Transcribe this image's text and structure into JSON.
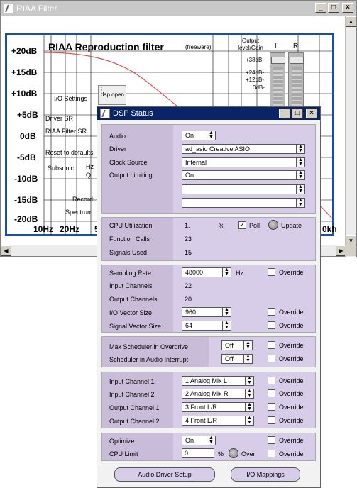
{
  "riaa_window": {
    "title": "RIAA Filter",
    "plot_title": "RIAA Reproduction filter",
    "freeware": "(freeware)",
    "db_labels": [
      "+20dB",
      "+15dB",
      "+10dB",
      "+5dB",
      "0dB",
      "-5dB",
      "-10dB",
      "-15dB",
      "-20dB"
    ],
    "freq_labels": [
      "10Hz",
      "20Hz",
      "5",
      "0kh"
    ],
    "side_labels": {
      "io_settings": "I/O Settings",
      "driver_sr": "Driver SR",
      "riaa_filter_sr": "RIAA Filter SR",
      "reset": "Reset to defaults",
      "subsonic": "Subsonic",
      "hz": "Hz",
      "q": "Q",
      "record": "Record:",
      "spectrum": "Spectrum:"
    },
    "dsp_open": "dsp open",
    "output_label": "Output level/Gain",
    "meter_labels": [
      "+38dB-",
      "+24dB-",
      "+12dB-",
      "0dB-"
    ],
    "meter_channels": [
      "L",
      "R"
    ]
  },
  "dsp_window": {
    "title": "DSP Status",
    "section1": {
      "audio_label": "Audio",
      "audio_value": "On",
      "driver_label": "Driver",
      "driver_value": "ad_asio Creative ASIO",
      "clock_label": "Clock Source",
      "clock_value": "Internal",
      "limiting_label": "Output Limiting",
      "limiting_value": "On"
    },
    "section2": {
      "cpu_label": "CPU Utilization",
      "cpu_value": "1.",
      "cpu_unit": "%",
      "poll_label": "Poll",
      "poll_checked": "✓",
      "update_label": "Update",
      "fcalls_label": "Function Calls",
      "fcalls_value": "23",
      "signals_label": "Signals Used",
      "signals_value": "15"
    },
    "section3": {
      "sr_label": "Sampling Rate",
      "sr_value": "48000",
      "sr_unit": "Hz",
      "in_ch_label": "Input Channels",
      "in_ch_value": "22",
      "out_ch_label": "Output Channels",
      "out_ch_value": "20",
      "io_vec_label": "I/O Vector Size",
      "io_vec_value": "960",
      "sig_vec_label": "Signal Vector Size",
      "sig_vec_value": "64",
      "override": "Override"
    },
    "section4": {
      "max_sched_label": "Max Scheduler in Overdrive",
      "max_sched_value": "Off",
      "sched_audio_label": "Scheduler in Audio Interrupt",
      "sched_audio_value": "Off",
      "override": "Override"
    },
    "section5": {
      "in1_label": "Input Channel 1",
      "in1_value": "1 Analog Mix L",
      "in2_label": "Input Channel 2",
      "in2_value": "2 Analog Mix R",
      "out1_label": "Output Channel 1",
      "out1_value": "3 Front L/R",
      "out2_label": "Output Channel 2",
      "out2_value": "4 Front L/R",
      "override": "Override"
    },
    "section6": {
      "optimize_label": "Optimize",
      "optimize_value": "On",
      "cpu_limit_label": "CPU Limit",
      "cpu_limit_value": "0",
      "cpu_limit_unit": "%",
      "over_label": "Over",
      "override": "Override"
    },
    "buttons": {
      "driver_setup": "Audio Driver Setup",
      "io_mappings": "I/O Mappings"
    }
  }
}
